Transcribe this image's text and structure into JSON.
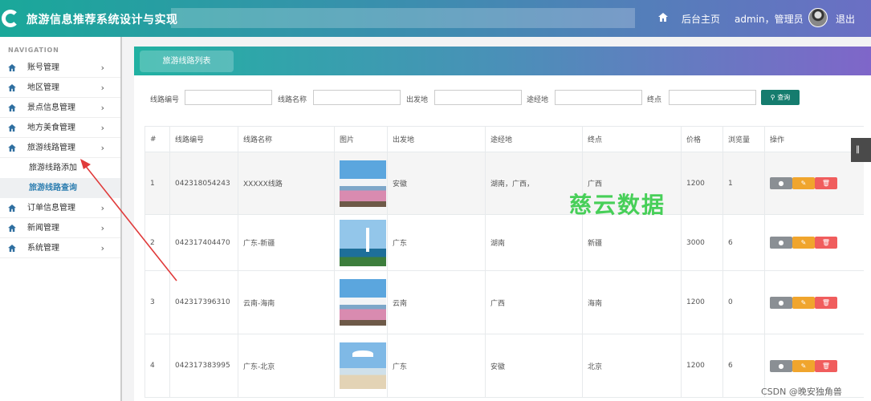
{
  "header": {
    "app_title": "旅游信息推荐系统设计与实现",
    "home_label": "后台主页",
    "user_label": "admin，管理员",
    "logout_label": "退出"
  },
  "sidebar": {
    "section_label": "NAVIGATION",
    "items": [
      {
        "label": "账号管理"
      },
      {
        "label": "地区管理"
      },
      {
        "label": "景点信息管理"
      },
      {
        "label": "地方美食管理"
      },
      {
        "label": "旅游线路管理"
      },
      {
        "label": "订单信息管理"
      },
      {
        "label": "新闻管理"
      },
      {
        "label": "系统管理"
      }
    ],
    "sub_items": [
      {
        "label": "旅游线路添加"
      },
      {
        "label": "旅游线路查询"
      }
    ]
  },
  "main": {
    "tab_label": "旅游线路列表",
    "search": {
      "fields": [
        {
          "label": "线路编号"
        },
        {
          "label": "线路名称"
        },
        {
          "label": "出发地"
        },
        {
          "label": "途经地"
        },
        {
          "label": "终点"
        }
      ],
      "button_label": "查询"
    },
    "table": {
      "headers": [
        "#",
        "线路编号",
        "线路名称",
        "图片",
        "出发地",
        "途经地",
        "终点",
        "价格",
        "浏览量",
        "操作"
      ],
      "rows": [
        {
          "idx": "1",
          "code": "042318054243",
          "name": "XXXXX线路",
          "start": "安徽",
          "via": "湖南，广西，",
          "end": "广西",
          "price": "1200",
          "views": "1"
        },
        {
          "idx": "2",
          "code": "042317404470",
          "name": "广东-新疆",
          "start": "广东",
          "via": "湖南",
          "end": "新疆",
          "price": "3000",
          "views": "6"
        },
        {
          "idx": "3",
          "code": "042317396310",
          "name": "云南-海南",
          "start": "云南",
          "via": "广西",
          "end": "海南",
          "price": "1200",
          "views": "0"
        },
        {
          "idx": "4",
          "code": "042317383995",
          "name": "广东-北京",
          "start": "广东",
          "via": "安徽",
          "end": "北京",
          "price": "1200",
          "views": "6"
        }
      ]
    }
  },
  "overlay": {
    "watermark": "慈云数据",
    "credit": "CSDN @晚安独角兽"
  },
  "colors": {
    "accent": "#157c6e",
    "active_link": "#2f7fb1",
    "edit": "#f0a52d",
    "delete": "#f05d5d",
    "info": "#8a8f94",
    "arrow": "#e03a3a"
  }
}
